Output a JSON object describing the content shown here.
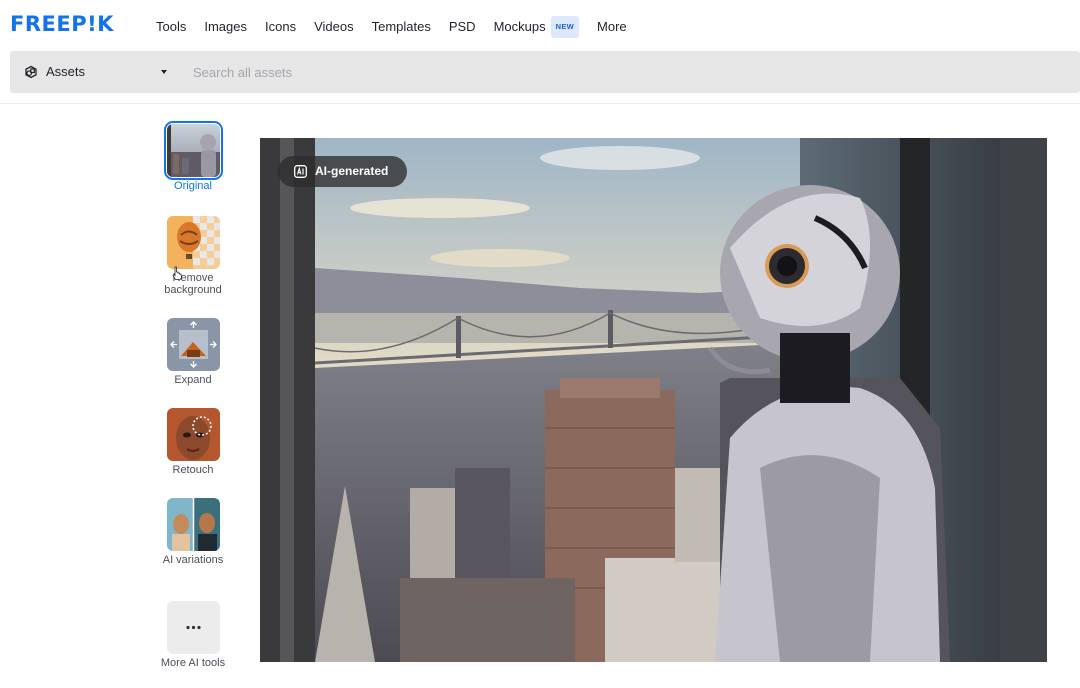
{
  "brand": {
    "logo_text": "FREEP!K"
  },
  "nav": {
    "items": [
      "Tools",
      "Images",
      "Icons",
      "Videos",
      "Templates",
      "PSD",
      "Mockups",
      "More"
    ],
    "mockups_badge": "NEW"
  },
  "search": {
    "asset_type": "Assets",
    "placeholder": "Search all assets"
  },
  "tools": [
    {
      "label": "Original",
      "active": true
    },
    {
      "label": "Remove background"
    },
    {
      "label": "Expand"
    },
    {
      "label": "Retouch"
    },
    {
      "label": "AI variations"
    },
    {
      "label": "More AI tools"
    }
  ],
  "image": {
    "badge": "AI-generated"
  },
  "colors": {
    "accent": "#1273eb",
    "searchbar": "#e6e6e6"
  }
}
